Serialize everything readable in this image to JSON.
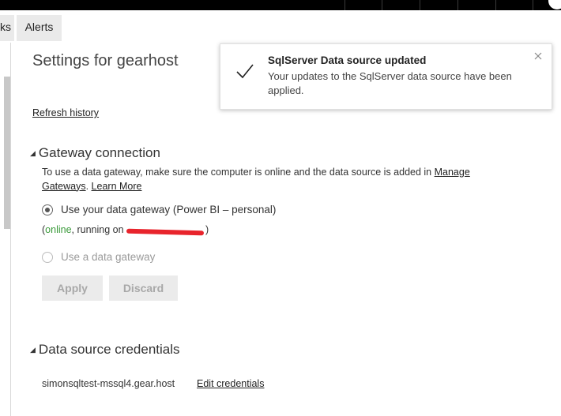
{
  "tabs": {
    "partial_label": "ks",
    "alerts_label": "Alerts"
  },
  "settings": {
    "title": "Settings for gearhost",
    "refresh_history": "Refresh history"
  },
  "gateway": {
    "heading": "Gateway connection",
    "desc_text": "To use a data gateway, make sure the computer is online and the data source is added in ",
    "manage_link": "Manage Gateways",
    "learn_more": "Learn More",
    "option_personal": "Use your data gateway (Power BI – personal)",
    "status_open": "(",
    "status_online": "online",
    "status_running": ", running on ",
    "status_close": ")",
    "option_gateway": "Use a data gateway",
    "apply": "Apply",
    "discard": "Discard"
  },
  "credentials": {
    "heading": "Data source credentials",
    "host": "simonsqltest-mssql4.gear.host",
    "edit": "Edit credentials"
  },
  "toast": {
    "title": "SqlServer Data source updated",
    "message": "Your updates to the SqlServer data source have been applied."
  },
  "icons": {
    "check": "check-icon",
    "close": "close-icon",
    "collapse": "collapse-triangle-icon"
  },
  "colors": {
    "online": "#3a9a3a",
    "redaction": "#e8242c"
  }
}
